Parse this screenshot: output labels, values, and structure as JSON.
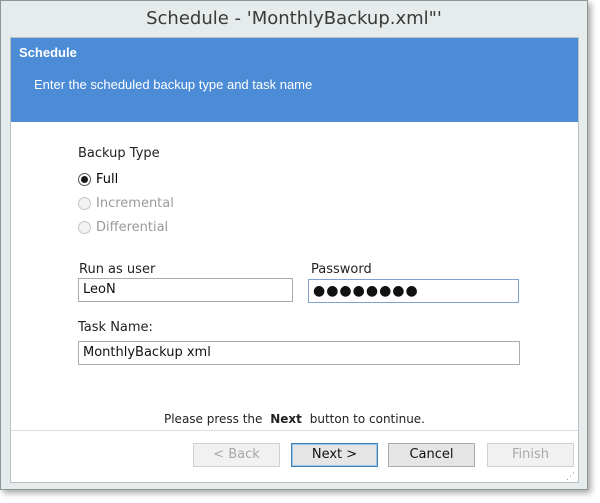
{
  "window": {
    "title": "Schedule -  'MonthlyBackup.xml\"'"
  },
  "banner": {
    "title": "Schedule",
    "subtitle": "Enter the scheduled backup type and task name"
  },
  "backup_type": {
    "label": "Backup Type",
    "options": [
      {
        "label": "Full",
        "checked": true,
        "enabled": true
      },
      {
        "label": "Incremental",
        "checked": false,
        "enabled": false
      },
      {
        "label": "Differential",
        "checked": false,
        "enabled": false
      }
    ]
  },
  "run_as": {
    "label": "Run as user",
    "value": "LeoN"
  },
  "password": {
    "label": "Password",
    "value": "●●●●●●●●"
  },
  "task_name": {
    "label": "Task Name:",
    "value": "MonthlyBackup xml"
  },
  "hint": {
    "before": "Please press the",
    "keyword": "Next",
    "after": "button to continue."
  },
  "buttons": {
    "back": "< Back",
    "next": "Next >",
    "cancel": "Cancel",
    "finish": "Finish"
  },
  "colors": {
    "banner": "#4c8bd6",
    "frame": "#e6ebec"
  }
}
